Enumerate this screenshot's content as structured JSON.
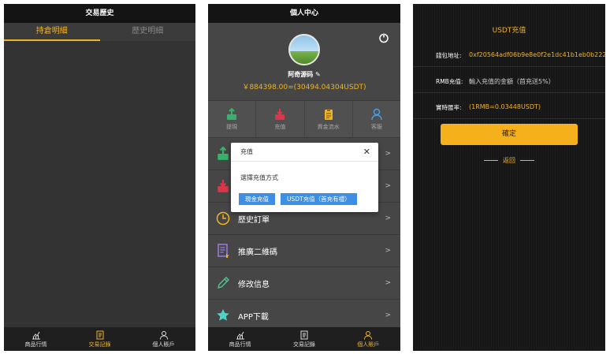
{
  "colors": {
    "accent": "#f0b323",
    "modal_button": "#3d8fe3",
    "confirm": "#f5b01c"
  },
  "trade_history": {
    "title": "交易歷史",
    "tabs": [
      {
        "label": "持倉明細",
        "active": true
      },
      {
        "label": "歷史明細",
        "active": false
      }
    ]
  },
  "tabbar": {
    "items": [
      {
        "label": "商品行情",
        "icon": "chart-icon"
      },
      {
        "label": "交易記錄",
        "icon": "document-icon"
      },
      {
        "label": "個人賬戶",
        "icon": "user-icon"
      }
    ]
  },
  "personal": {
    "title": "個人中心",
    "username": "阿奇源码",
    "balance": "￥884398.00=(30494.04304USDT)",
    "quick": [
      {
        "label": "提現",
        "icon": "withdraw-icon"
      },
      {
        "label": "充值",
        "icon": "deposit-icon"
      },
      {
        "label": "資金流水",
        "icon": "ledger-icon"
      },
      {
        "label": "客服",
        "icon": "support-icon"
      }
    ],
    "menu": [
      {
        "label": "",
        "icon": "withdraw-icon"
      },
      {
        "label": "",
        "icon": "deposit-icon"
      },
      {
        "label": "歷史訂單",
        "icon": "clock-icon"
      },
      {
        "label": "推廣二維碼",
        "icon": "qrcode-icon"
      },
      {
        "label": "修改信息",
        "icon": "pencil-icon"
      },
      {
        "label": "APP下載",
        "icon": "star-icon"
      }
    ],
    "chevron": ">"
  },
  "modal": {
    "title": "充值",
    "close": "✕",
    "prompt": "選擇充值方式",
    "cash_button": "現金充值",
    "usdt_button": "USDT充值（首充有禮）"
  },
  "usdt": {
    "title": "USDT充值",
    "wallet_label": "錢包地址:",
    "wallet_value": "0xf20564adf06b9e8e0f2e1dc41b1eb0b222",
    "rmb_label": "RMB充值:",
    "rmb_placeholder": "輸入充值的金額（首充送5%）",
    "rate_label": "實時匯率:",
    "rate_value": "(1RMB=0.03448USDT)",
    "confirm": "確定",
    "back": "返回"
  }
}
